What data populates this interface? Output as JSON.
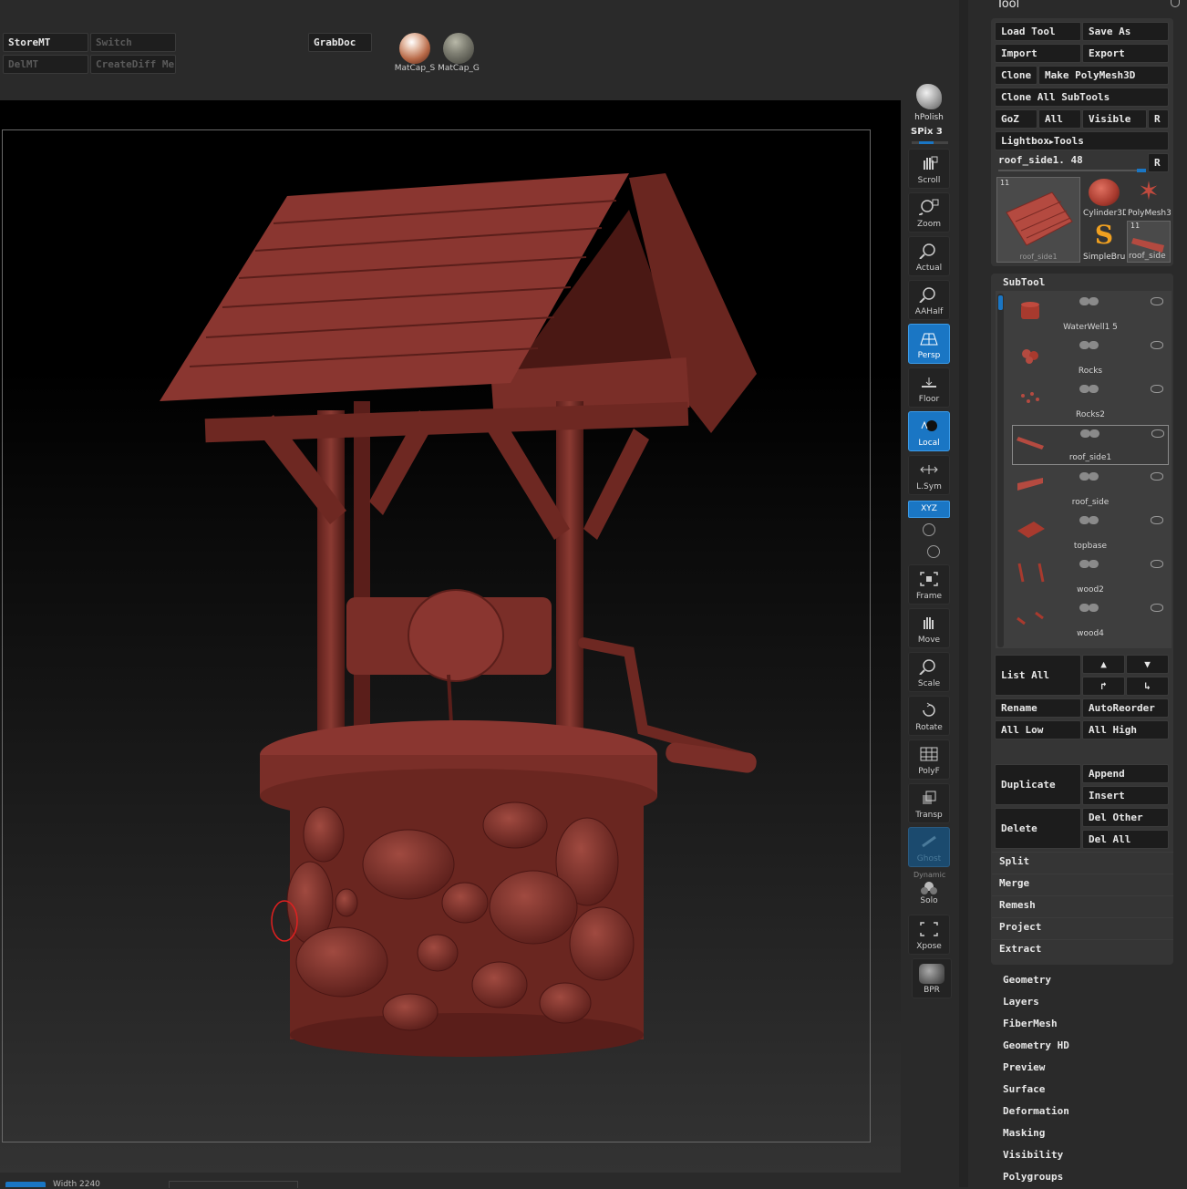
{
  "top_shelf": {
    "storemt": "StoreMT",
    "switch": "Switch",
    "delmt": "DelMT",
    "creatediff": "CreateDiff Mes",
    "grabdoc": "GrabDoc",
    "matcap_s": "MatCap_S",
    "matcap_g": "MatCap_G"
  },
  "right_shelf": {
    "hpolish": "hPolish",
    "spix": "SPix 3",
    "buttons": [
      {
        "label": "Scroll",
        "icon": "hand-scroll-icon",
        "active": false
      },
      {
        "label": "Zoom",
        "icon": "magnifier-zoom-icon",
        "active": false
      },
      {
        "label": "Actual",
        "icon": "magnifier-actual-icon",
        "active": false
      },
      {
        "label": "AAHalf",
        "icon": "magnifier-aahalf-icon",
        "active": false
      },
      {
        "label": "Persp",
        "icon": "perspective-grid-icon",
        "active": true
      },
      {
        "label": "Floor",
        "icon": "floor-icon",
        "active": false
      },
      {
        "label": "Local",
        "icon": "local-transform-icon",
        "active": true
      },
      {
        "label": "L.Sym",
        "icon": "local-symmetry-icon",
        "active": false
      },
      {
        "label": "XYZ",
        "icon": "xyz-rotate-icon",
        "active": true
      },
      {
        "label": "Frame",
        "icon": "frame-icon",
        "active": false
      },
      {
        "label": "Move",
        "icon": "hand-move-icon",
        "active": false
      },
      {
        "label": "Scale",
        "icon": "magnifier-scale-icon",
        "active": false
      },
      {
        "label": "Rotate",
        "icon": "rotate-icon",
        "active": false
      },
      {
        "label": "PolyF",
        "icon": "polyframe-grid-icon",
        "active": false
      },
      {
        "label": "Transp",
        "icon": "transparency-icon",
        "active": false
      },
      {
        "label": "Ghost",
        "icon": "ghost-icon",
        "active": false
      },
      {
        "label": "Solo",
        "icon": "solo-icon",
        "active": false
      },
      {
        "label": "Xpose",
        "icon": "xpose-icon",
        "active": false
      },
      {
        "label": "BPR",
        "icon": "bpr-render-icon",
        "active": false
      }
    ],
    "dynamic": "Dynamic"
  },
  "tool_panel": {
    "title": "Tool",
    "load_tool": "Load Tool",
    "save_as": "Save As",
    "import": "Import",
    "export": "Export",
    "clone": "Clone",
    "make_polymesh": "Make PolyMesh3D",
    "clone_all": "Clone All SubTools",
    "goz": "GoZ",
    "all": "All",
    "visible": "Visible",
    "r": "R",
    "lightbox": "Lightbox",
    "tools": "Tools",
    "current_tool": "roof_side1. 48",
    "thumbs": {
      "main_label": "roof_side1",
      "main_count": "11",
      "cylinder": "Cylinder3D",
      "polymesh": "PolyMesh3",
      "simplebrush": "SimpleBru",
      "roof_small": "roof_side",
      "roof_small_count": "11"
    }
  },
  "subtool": {
    "header": "SubTool",
    "items": [
      {
        "name": "WaterWell1 5",
        "selected": false
      },
      {
        "name": "Rocks",
        "selected": false
      },
      {
        "name": "Rocks2",
        "selected": false
      },
      {
        "name": "roof_side1",
        "selected": true
      },
      {
        "name": "roof_side",
        "selected": false
      },
      {
        "name": "topbase",
        "selected": false
      },
      {
        "name": "wood2",
        "selected": false
      },
      {
        "name": "wood4",
        "selected": false
      }
    ],
    "list_all": "List All",
    "rename": "Rename",
    "autoreorder": "AutoReorder",
    "all_low": "All Low",
    "all_high": "All High",
    "duplicate": "Duplicate",
    "append": "Append",
    "insert": "Insert",
    "delete": "Delete",
    "del_other": "Del Other",
    "del_all": "Del All",
    "split": "Split",
    "merge": "Merge",
    "remesh": "Remesh",
    "project": "Project",
    "extract": "Extract"
  },
  "menu": {
    "items": [
      "Geometry",
      "Layers",
      "FiberMesh",
      "Geometry HD",
      "Preview",
      "Surface",
      "Deformation",
      "Masking",
      "Visibility",
      "Polygroups"
    ]
  },
  "bottom": {
    "width_label": "Width 2240"
  },
  "colors": {
    "accent": "#1a76c4",
    "model": "#7a2e28"
  }
}
